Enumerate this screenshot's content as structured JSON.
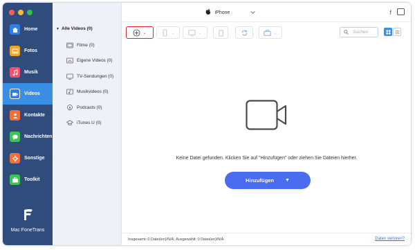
{
  "window": {
    "device_name": "iPhone"
  },
  "sidebar": {
    "items": [
      {
        "label": "Home",
        "icon": "home-icon",
        "color": "#2f7fe8"
      },
      {
        "label": "Fotos",
        "icon": "photos-icon",
        "color": "#f4a62b"
      },
      {
        "label": "Musik",
        "icon": "music-icon",
        "color": "#f0526b"
      },
      {
        "label": "Videos",
        "icon": "videos-icon",
        "color": "#2f7fe8",
        "active": true
      },
      {
        "label": "Kontakte",
        "icon": "contacts-icon",
        "color": "#f26f3a"
      },
      {
        "label": "Nachrichten",
        "icon": "messages-icon",
        "color": "#3cc45a"
      },
      {
        "label": "Sonstige",
        "icon": "other-icon",
        "color": "#f26f3a"
      },
      {
        "label": "Toolkit",
        "icon": "toolkit-icon",
        "color": "#3cc45a"
      }
    ],
    "brand": "Mac FoneTrans"
  },
  "categories": {
    "title": "Alle Videos (0)",
    "items": [
      {
        "label": "Filme (0)",
        "icon": "film-icon"
      },
      {
        "label": "Eigene Videos (0)",
        "icon": "home-video-icon"
      },
      {
        "label": "TV-Sendungen (0)",
        "icon": "tv-icon"
      },
      {
        "label": "Musikvideos (0)",
        "icon": "music-video-icon"
      },
      {
        "label": "Podcasts (0)",
        "icon": "podcast-icon"
      },
      {
        "label": "iTunes U (0)",
        "icon": "itunes-u-icon"
      }
    ]
  },
  "toolbar": {
    "search_placeholder": "Suchen"
  },
  "main": {
    "empty_message": "Keine Datei gefunden. Klicken Sie auf \"Hinzufügen\" oder ziehen Sie Dateien hierher.",
    "add_button": "Hinzufügen"
  },
  "status": {
    "summary": "Insgesamt: 0 Datei(en)/N/A; Ausgewählt: 0 Datei(en)/N/A",
    "lost_link": "Daten verloren?"
  },
  "colors": {
    "sidebar_bg": "#2f4c7c",
    "accent": "#3a8ee6",
    "primary_button": "#4a6cf0",
    "highlight_border": "#e8202a"
  }
}
